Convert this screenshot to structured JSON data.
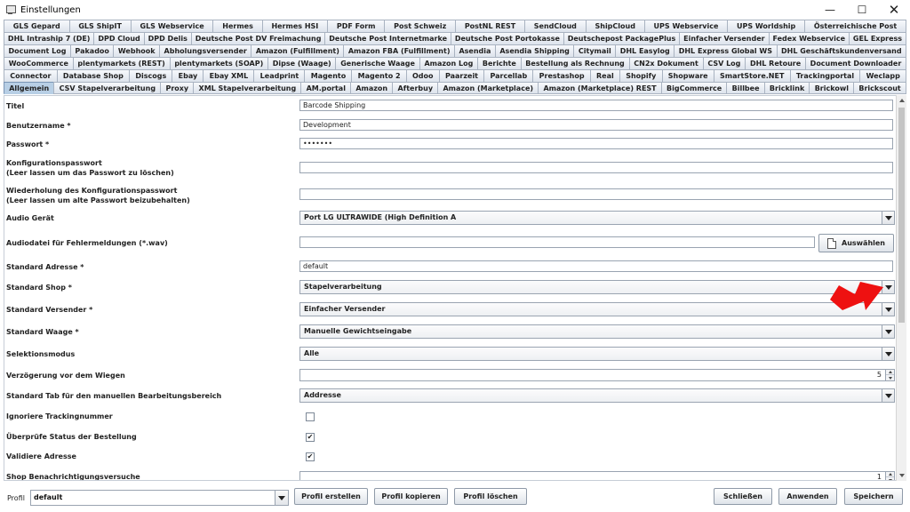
{
  "window": {
    "title": "Einstellungen",
    "minimize": "—",
    "maximize": "☐",
    "close": "✕"
  },
  "tab_rows": [
    [
      "GLS Gepard",
      "GLS ShipIT",
      "GLS Webservice",
      "Hermes",
      "Hermes HSI",
      "PDF Form",
      "Post Schweiz",
      "PostNL REST",
      "SendCloud",
      "ShipCloud",
      "UPS Webservice",
      "UPS Worldship",
      "Österreichische Post"
    ],
    [
      "DHL Intraship 7 (DE)",
      "DPD Cloud",
      "DPD Delis",
      "Deutsche Post DV Freimachung",
      "Deutsche Post Internetmarke",
      "Deutsche Post Portokasse",
      "Deutschepost PackagePlus",
      "Einfacher Versender",
      "Fedex Webservice",
      "GEL Express"
    ],
    [
      "Document Log",
      "Pakadoo",
      "Webhook",
      "Abholungsversender",
      "Amazon (Fulfillment)",
      "Amazon FBA (Fulfillment)",
      "Asendia",
      "Asendia Shipping",
      "Citymail",
      "DHL Easylog",
      "DHL Express Global WS",
      "DHL Geschäftskundenversand"
    ],
    [
      "WooCommerce",
      "plentymarkets (REST)",
      "plentymarkets (SOAP)",
      "Dipse (Waage)",
      "Generische Waage",
      "Amazon Log",
      "Berichte",
      "Bestellung als Rechnung",
      "CN2x Dokument",
      "CSV Log",
      "DHL Retoure",
      "Document Downloader"
    ],
    [
      "Connector",
      "Database Shop",
      "Discogs",
      "Ebay",
      "Ebay XML",
      "Leadprint",
      "Magento",
      "Magento 2",
      "Odoo",
      "Paarzeit",
      "Parcellab",
      "Prestashop",
      "Real",
      "Shopify",
      "Shopware",
      "SmartStore.NET",
      "Trackingportal",
      "Weclapp"
    ],
    [
      "Allgemein",
      "CSV Stapelverarbeitung",
      "Proxy",
      "XML Stapelverarbeitung",
      "AM.portal",
      "Amazon",
      "Afterbuy",
      "Amazon (Marketplace)",
      "Amazon (Marketplace) REST",
      "BigCommerce",
      "Billbee",
      "Bricklink",
      "Brickowl",
      "Brickscout"
    ]
  ],
  "selected_tab": "Allgemein",
  "form": {
    "titel": {
      "label": "Titel",
      "value": "Barcode Shipping"
    },
    "benutzername": {
      "label": "Benutzername *",
      "value": "Development"
    },
    "passwort": {
      "label": "Passwort *",
      "value": "•••••••"
    },
    "konfig_passwort": {
      "label": "Konfigurationspasswort",
      "hint": "(Leer lassen um das Passwort zu löschen)",
      "value": ""
    },
    "konfig_wiederholung": {
      "label": "Wiederholung des Konfigurationspasswort",
      "hint": "(Leer lassen um alte Passwort beizubehalten)",
      "value": ""
    },
    "audio_geraet": {
      "label": "Audio Gerät",
      "value": "Port LG ULTRAWIDE (High Definition A"
    },
    "audiodatei": {
      "label": "Audiodatei für Fehlermeldungen (*.wav)",
      "value": "",
      "button": "Auswählen"
    },
    "standard_adresse": {
      "label": "Standard Adresse *",
      "value": "default"
    },
    "standard_shop": {
      "label": "Standard Shop *",
      "value": "Stapelverarbeitung"
    },
    "standard_versender": {
      "label": "Standard Versender *",
      "value": "Einfacher Versender"
    },
    "standard_waage": {
      "label": "Standard Waage *",
      "value": "Manuelle Gewichtseingabe"
    },
    "selektionsmodus": {
      "label": "Selektionsmodus",
      "value": "Alle"
    },
    "verzoegerung": {
      "label": "Verzögerung vor dem Wiegen",
      "value": "5"
    },
    "standard_tab": {
      "label": "Standard Tab für den manuellen Bearbeitungsbereich",
      "value": "Addresse"
    },
    "ignoriere_tracking": {
      "label": "Ignoriere Trackingnummer",
      "checked": ""
    },
    "ueberpruefe_status": {
      "label": "Überprüfe Status der Bestellung",
      "checked": "✔"
    },
    "validiere_adresse": {
      "label": "Validiere Adresse",
      "checked": "✔"
    },
    "shop_benachrichtigung": {
      "label": "Shop Benachrichtigungsversuche",
      "value": "1"
    }
  },
  "bottom": {
    "profile_label": "Profil",
    "profile_value": "default",
    "profil_erstellen": "Profil erstellen",
    "profil_kopieren": "Profil kopieren",
    "profil_loeschen": "Profil löschen",
    "schliessen": "Schließen",
    "anwenden": "Anwenden",
    "speichern": "Speichern"
  },
  "colors": {
    "annotation_arrow": "#ee1111",
    "selected_tab": "#b8cfe5"
  }
}
